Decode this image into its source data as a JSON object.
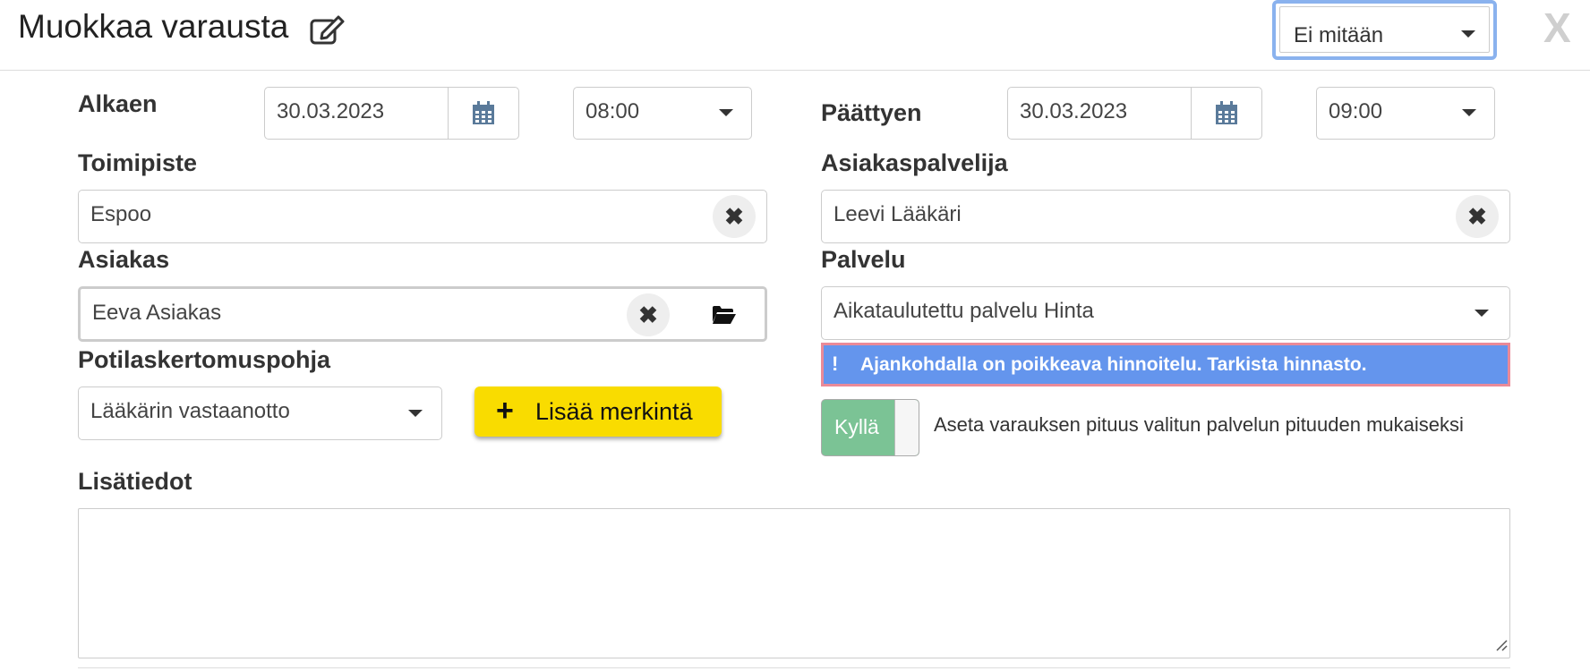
{
  "header": {
    "title": "Muokkaa varausta",
    "edit_icon": "edit-icon",
    "status_select_value": "Ei mitään",
    "close_label": "X"
  },
  "start": {
    "label": "Alkaen",
    "date": "30.03.2023",
    "time": "08:00"
  },
  "end": {
    "label": "Päättyen",
    "date": "30.03.2023",
    "time": "09:00"
  },
  "location": {
    "label": "Toimipiste",
    "value": "Espoo"
  },
  "staff": {
    "label": "Asiakaspalvelija",
    "value": "Leevi Lääkäri"
  },
  "customer": {
    "label": "Asiakas",
    "value": "Eeva Asiakas"
  },
  "service": {
    "label": "Palvelu",
    "value": "Aikataulutettu palvelu Hinta",
    "alert_icon": "!",
    "alert": "Ajankohdalla on poikkeava hinnoitelu. Tarkista hinnasto."
  },
  "template": {
    "label": "Potilaskertomuspohja",
    "value": "Lääkärin vastaanotto",
    "add_button": "Lisää merkintä"
  },
  "duration_toggle": {
    "state_label": "Kyllä",
    "description": "Aseta varauksen pituus valitun palvelun pituuden mukaiseksi"
  },
  "notes": {
    "label": "Lisätiedot",
    "value": ""
  },
  "colors": {
    "alert_bg": "#6495ed",
    "alert_border": "#ea8a98",
    "toggle_on": "#7bc395",
    "add_button": "#f9dc00",
    "focus_ring": "#8ab2ee"
  }
}
